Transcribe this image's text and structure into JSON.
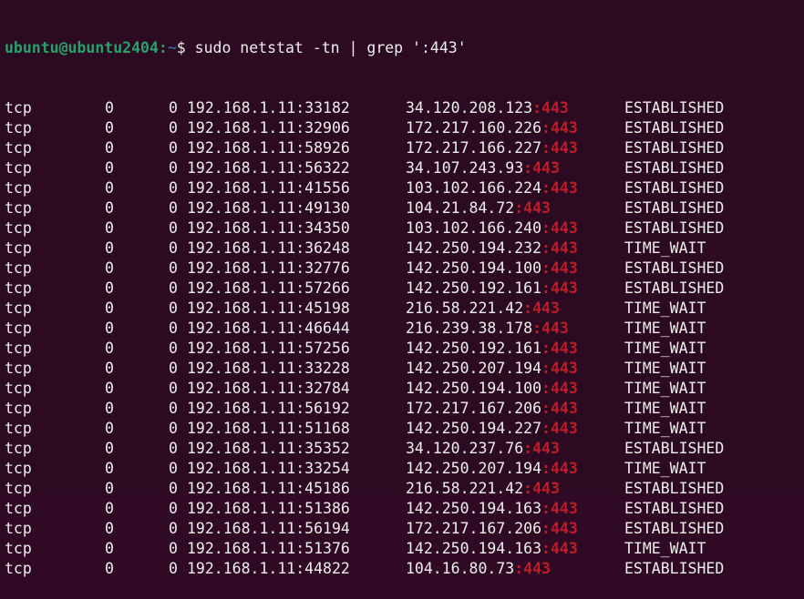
{
  "prompt": {
    "user_host": "ubuntu@ubuntu2404",
    "separator": ":",
    "path": "~",
    "symbol": "$ ",
    "command": "sudo netstat -tn | grep ':443'"
  },
  "colors": {
    "background": "#2c0a22",
    "text": "#eeeeec",
    "user_host": "#26a269",
    "path": "#3465a4",
    "grep_match": "#c01c28"
  },
  "match_text": ":443",
  "rows": [
    {
      "proto": "tcp",
      "recv_q": "0",
      "send_q": "0",
      "local": "192.168.1.11:33182",
      "foreign_ip": "34.120.208.123",
      "state": "ESTABLISHED"
    },
    {
      "proto": "tcp",
      "recv_q": "0",
      "send_q": "0",
      "local": "192.168.1.11:32906",
      "foreign_ip": "172.217.160.226",
      "state": "ESTABLISHED"
    },
    {
      "proto": "tcp",
      "recv_q": "0",
      "send_q": "0",
      "local": "192.168.1.11:58926",
      "foreign_ip": "172.217.166.227",
      "state": "ESTABLISHED"
    },
    {
      "proto": "tcp",
      "recv_q": "0",
      "send_q": "0",
      "local": "192.168.1.11:56322",
      "foreign_ip": "34.107.243.93",
      "state": "ESTABLISHED"
    },
    {
      "proto": "tcp",
      "recv_q": "0",
      "send_q": "0",
      "local": "192.168.1.11:41556",
      "foreign_ip": "103.102.166.224",
      "state": "ESTABLISHED"
    },
    {
      "proto": "tcp",
      "recv_q": "0",
      "send_q": "0",
      "local": "192.168.1.11:49130",
      "foreign_ip": "104.21.84.72",
      "state": "ESTABLISHED"
    },
    {
      "proto": "tcp",
      "recv_q": "0",
      "send_q": "0",
      "local": "192.168.1.11:34350",
      "foreign_ip": "103.102.166.240",
      "state": "ESTABLISHED"
    },
    {
      "proto": "tcp",
      "recv_q": "0",
      "send_q": "0",
      "local": "192.168.1.11:36248",
      "foreign_ip": "142.250.194.232",
      "state": "TIME_WAIT"
    },
    {
      "proto": "tcp",
      "recv_q": "0",
      "send_q": "0",
      "local": "192.168.1.11:32776",
      "foreign_ip": "142.250.194.100",
      "state": "ESTABLISHED"
    },
    {
      "proto": "tcp",
      "recv_q": "0",
      "send_q": "0",
      "local": "192.168.1.11:57266",
      "foreign_ip": "142.250.192.161",
      "state": "ESTABLISHED"
    },
    {
      "proto": "tcp",
      "recv_q": "0",
      "send_q": "0",
      "local": "192.168.1.11:45198",
      "foreign_ip": "216.58.221.42",
      "state": "TIME_WAIT"
    },
    {
      "proto": "tcp",
      "recv_q": "0",
      "send_q": "0",
      "local": "192.168.1.11:46644",
      "foreign_ip": "216.239.38.178",
      "state": "TIME_WAIT"
    },
    {
      "proto": "tcp",
      "recv_q": "0",
      "send_q": "0",
      "local": "192.168.1.11:57256",
      "foreign_ip": "142.250.192.161",
      "state": "TIME_WAIT"
    },
    {
      "proto": "tcp",
      "recv_q": "0",
      "send_q": "0",
      "local": "192.168.1.11:33228",
      "foreign_ip": "142.250.207.194",
      "state": "TIME_WAIT"
    },
    {
      "proto": "tcp",
      "recv_q": "0",
      "send_q": "0",
      "local": "192.168.1.11:32784",
      "foreign_ip": "142.250.194.100",
      "state": "TIME_WAIT"
    },
    {
      "proto": "tcp",
      "recv_q": "0",
      "send_q": "0",
      "local": "192.168.1.11:56192",
      "foreign_ip": "172.217.167.206",
      "state": "TIME_WAIT"
    },
    {
      "proto": "tcp",
      "recv_q": "0",
      "send_q": "0",
      "local": "192.168.1.11:51168",
      "foreign_ip": "142.250.194.227",
      "state": "TIME_WAIT"
    },
    {
      "proto": "tcp",
      "recv_q": "0",
      "send_q": "0",
      "local": "192.168.1.11:35352",
      "foreign_ip": "34.120.237.76",
      "state": "ESTABLISHED"
    },
    {
      "proto": "tcp",
      "recv_q": "0",
      "send_q": "0",
      "local": "192.168.1.11:33254",
      "foreign_ip": "142.250.207.194",
      "state": "TIME_WAIT"
    },
    {
      "proto": "tcp",
      "recv_q": "0",
      "send_q": "0",
      "local": "192.168.1.11:45186",
      "foreign_ip": "216.58.221.42",
      "state": "ESTABLISHED"
    },
    {
      "proto": "tcp",
      "recv_q": "0",
      "send_q": "0",
      "local": "192.168.1.11:51386",
      "foreign_ip": "142.250.194.163",
      "state": "ESTABLISHED"
    },
    {
      "proto": "tcp",
      "recv_q": "0",
      "send_q": "0",
      "local": "192.168.1.11:56194",
      "foreign_ip": "172.217.167.206",
      "state": "ESTABLISHED"
    },
    {
      "proto": "tcp",
      "recv_q": "0",
      "send_q": "0",
      "local": "192.168.1.11:51376",
      "foreign_ip": "142.250.194.163",
      "state": "TIME_WAIT"
    },
    {
      "proto": "tcp",
      "recv_q": "0",
      "send_q": "0",
      "local": "192.168.1.11:44822",
      "foreign_ip": "104.16.80.73",
      "state": "ESTABLISHED"
    }
  ]
}
